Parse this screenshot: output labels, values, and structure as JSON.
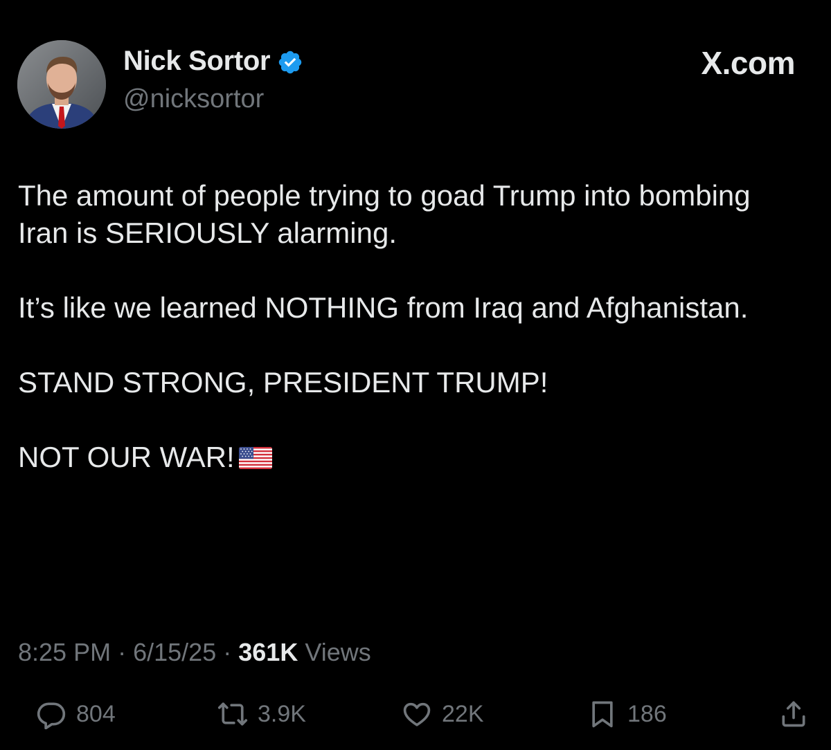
{
  "author": {
    "display_name": "Nick Sortor",
    "handle": "@nicksortor",
    "verified": true,
    "verified_color": "#1d9bf0"
  },
  "site": {
    "logo_text": "X.com"
  },
  "tweet": {
    "paragraphs": [
      "The amount of people trying to goad Trump into bombing Iran is SERIOUSLY alarming.",
      "It’s like we learned NOTHING from Iraq and Afghanistan.",
      "STAND STRONG, PRESIDENT TRUMP!",
      "NOT OUR WAR!"
    ],
    "trailing_emoji": "us-flag-emoji"
  },
  "meta": {
    "time": "8:25 PM",
    "separator": "·",
    "date": "6/15/25",
    "views_count": "361K",
    "views_label": "Views"
  },
  "actions": {
    "replies": {
      "icon": "reply-icon",
      "count": "804"
    },
    "reposts": {
      "icon": "repost-icon",
      "count": "3.9K"
    },
    "likes": {
      "icon": "heart-icon",
      "count": "22K"
    },
    "bookmarks": {
      "icon": "bookmark-icon",
      "count": "186"
    },
    "share": {
      "icon": "share-icon"
    }
  },
  "colors": {
    "background": "#000000",
    "text_primary": "#e7e9ea",
    "text_secondary": "#71767b"
  }
}
